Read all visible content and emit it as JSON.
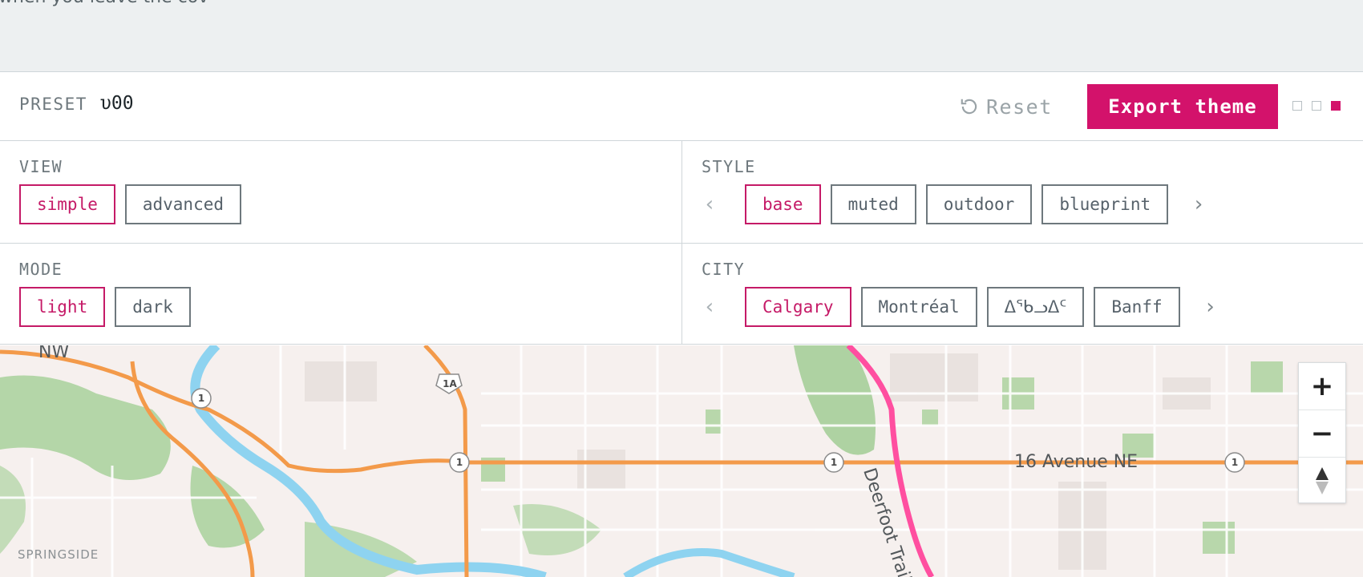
{
  "top_band": {
    "cut_text": "when you leave the cov"
  },
  "preset": {
    "label": "PRESET",
    "value": "υ00"
  },
  "toolbar": {
    "reset_label": "Reset",
    "export_label": "Export theme"
  },
  "colors": {
    "accent": "#d3126b",
    "motorway": "#ff4fa0",
    "primary_road": "#f39a4a",
    "water": "#8ed3f0",
    "park": "#a8cf9d"
  },
  "view": {
    "label": "VIEW",
    "options": [
      "simple",
      "advanced"
    ],
    "selected": "simple"
  },
  "style": {
    "label": "STYLE",
    "options": [
      "base",
      "muted",
      "outdoor",
      "blueprint"
    ],
    "selected": "base"
  },
  "mode": {
    "label": "MODE",
    "options": [
      "light",
      "dark"
    ],
    "selected": "light"
  },
  "city": {
    "label": "CITY",
    "options": [
      "Calgary",
      "Montréal",
      "ᐃᖃᓗᐃᑦ",
      "Banff"
    ],
    "selected": "Calgary"
  },
  "map": {
    "labels": {
      "nw": "NW",
      "avenue": "16 Avenue NE",
      "trail": "Deerfoot Trail",
      "neighbourhood": "SPRINGSIDE"
    },
    "shields": [
      "1",
      "1A",
      "1",
      "1",
      "1"
    ],
    "zoom": {
      "in": "+",
      "out": "−"
    }
  }
}
